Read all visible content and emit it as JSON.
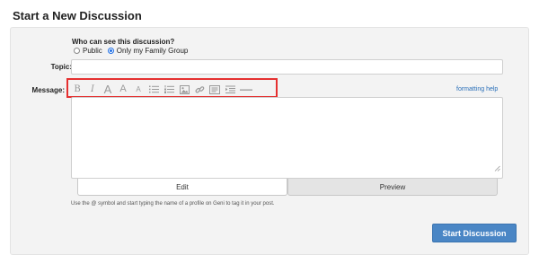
{
  "page": {
    "title": "Start a New Discussion"
  },
  "visibility": {
    "label": "Who can see this discussion?",
    "options": [
      {
        "label": "Public",
        "selected": false
      },
      {
        "label": "Only my Family Group",
        "selected": true
      }
    ]
  },
  "topic": {
    "label": "Topic:",
    "value": "",
    "placeholder": ""
  },
  "message": {
    "label": "Message:",
    "value": "",
    "formatting_help": "formatting help",
    "toolbar": [
      {
        "name": "bold-icon",
        "glyph": "B"
      },
      {
        "name": "italic-icon",
        "glyph": "I"
      },
      {
        "name": "font-size-large-icon",
        "glyph": "A"
      },
      {
        "name": "font-size-medium-icon",
        "glyph": "A"
      },
      {
        "name": "font-size-small-icon",
        "glyph": "A"
      },
      {
        "name": "bulleted-list-icon",
        "glyph": ""
      },
      {
        "name": "numbered-list-icon",
        "glyph": ""
      },
      {
        "name": "image-icon",
        "glyph": ""
      },
      {
        "name": "link-icon",
        "glyph": ""
      },
      {
        "name": "quote-icon",
        "glyph": ""
      },
      {
        "name": "indent-icon",
        "glyph": ""
      },
      {
        "name": "horizontal-rule-icon",
        "glyph": ""
      }
    ]
  },
  "tabs": [
    {
      "label": "Edit",
      "active": true
    },
    {
      "label": "Preview",
      "active": false
    }
  ],
  "hint": "Use the @ symbol and start typing the name of a profile on Geni to tag it in your post.",
  "submit": {
    "label": "Start Discussion"
  },
  "colors": {
    "accent": "#4a86c5",
    "highlight": "#e53030",
    "link": "#2a6fb8"
  }
}
